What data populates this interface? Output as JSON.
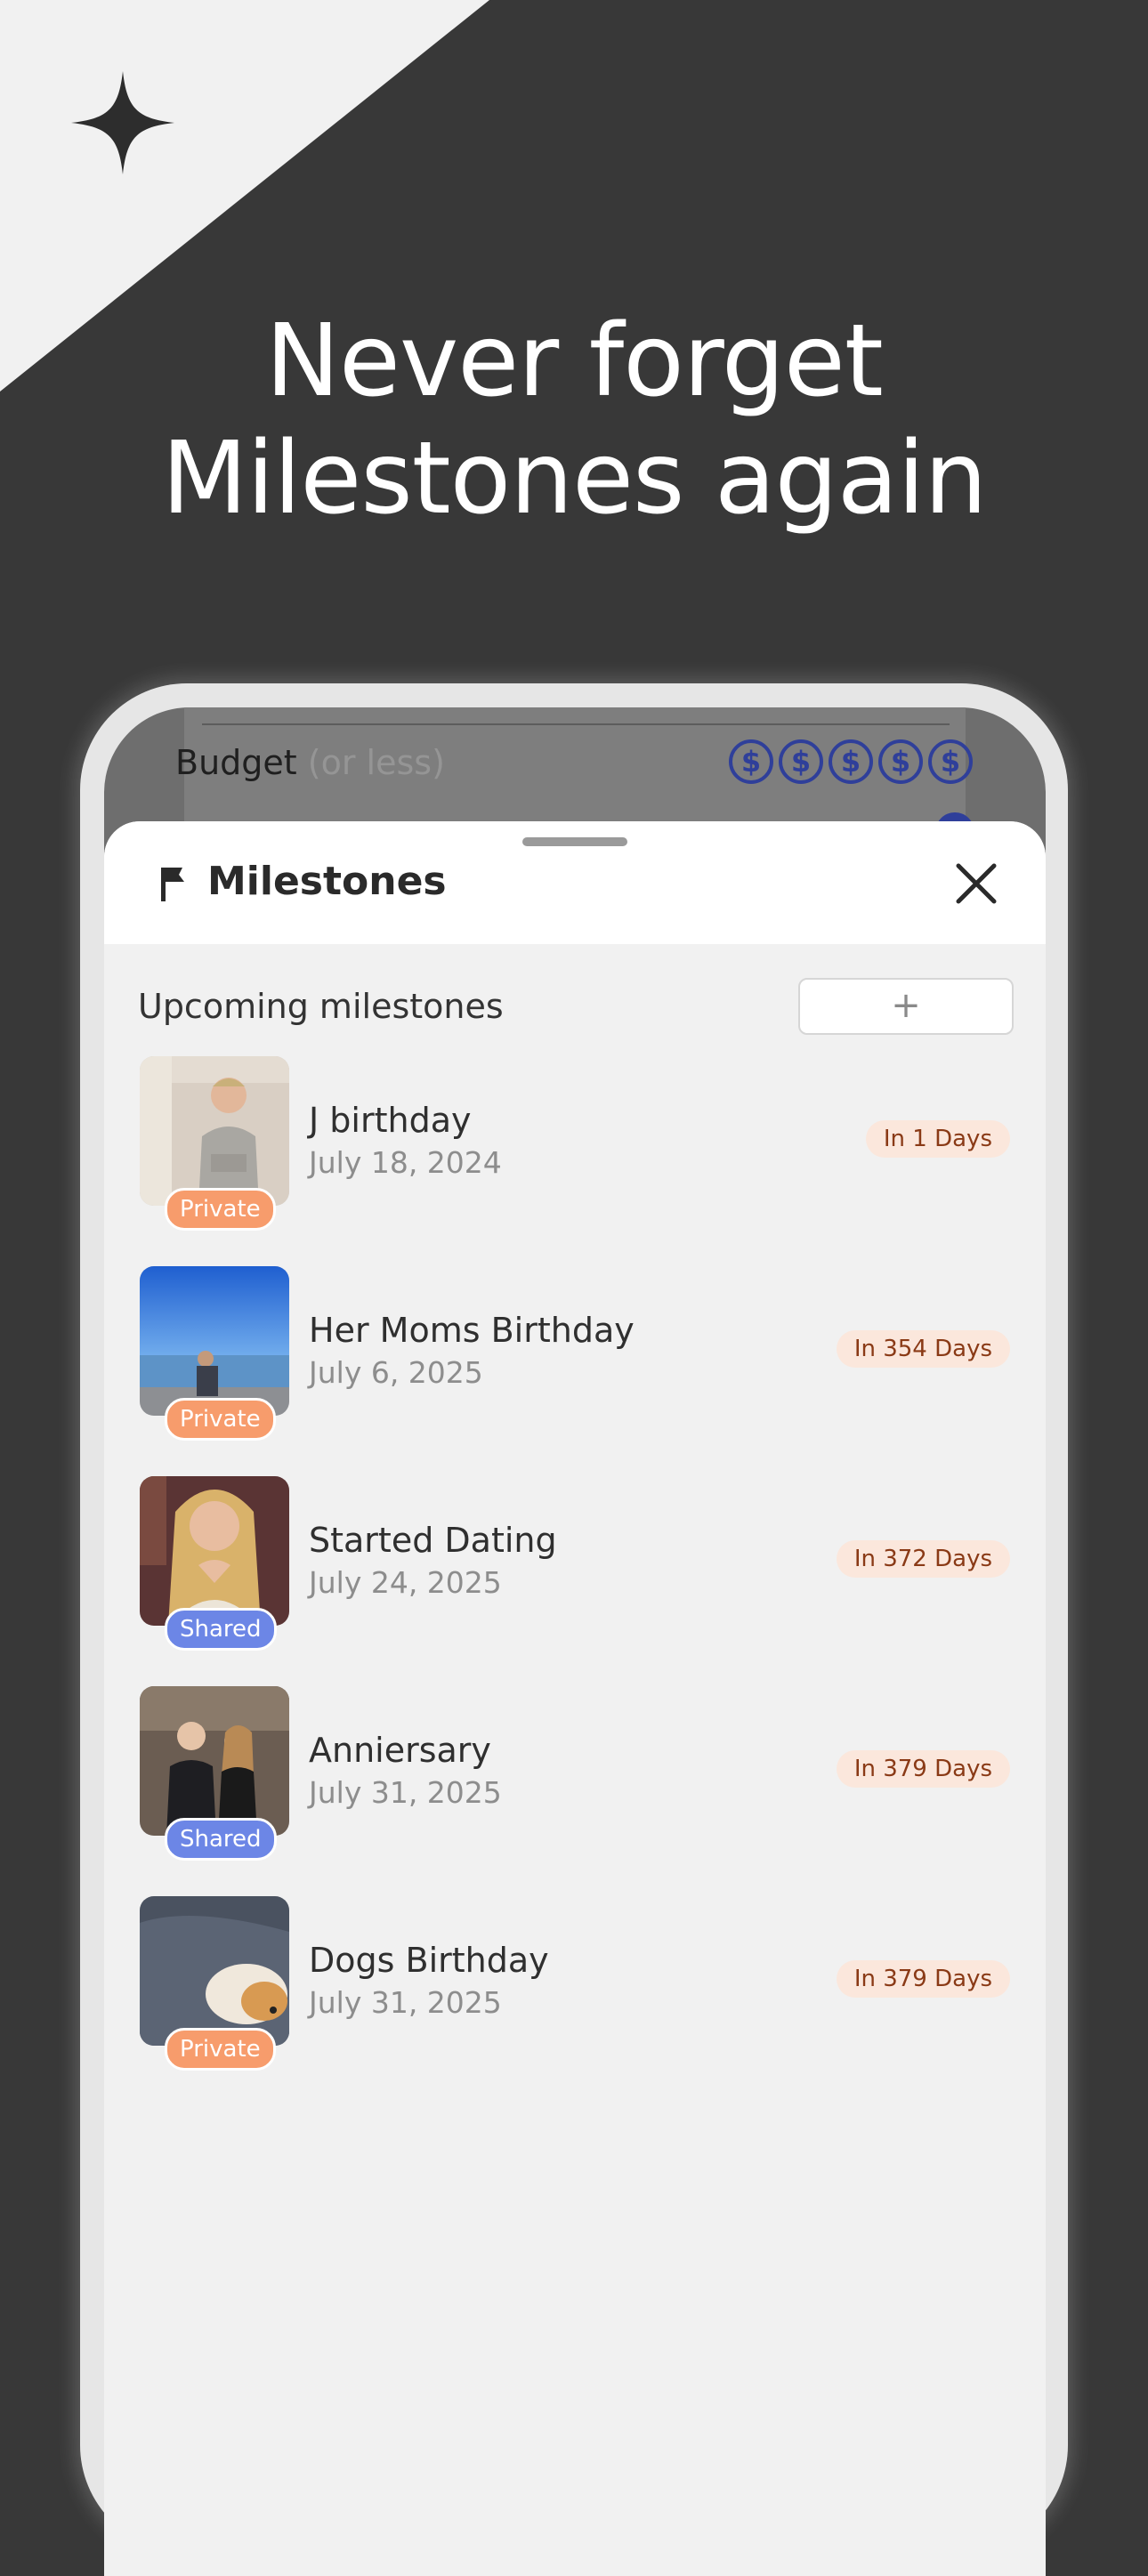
{
  "headline": {
    "line1": "Never forget",
    "line2": "Milestones again"
  },
  "background_screen": {
    "budget_label": "Budget",
    "budget_sub": "(or less)",
    "budget_icons": [
      "$",
      "$",
      "$",
      "$",
      "$"
    ]
  },
  "sheet": {
    "title": "Milestones",
    "section_title": "Upcoming milestones",
    "add_label": "+"
  },
  "milestones": [
    {
      "title": "J birthday",
      "date": "July 18, 2024",
      "badge": "Private",
      "badge_type": "private",
      "days": "In 1 Days"
    },
    {
      "title": "Her Moms Birthday",
      "date": "July 6, 2025",
      "badge": "Private",
      "badge_type": "private",
      "days": "In 354 Days"
    },
    {
      "title": "Started Dating",
      "date": "July 24, 2025",
      "badge": "Shared",
      "badge_type": "shared",
      "days": "In 372 Days"
    },
    {
      "title": "Anniersary",
      "date": "July 31, 2025",
      "badge": "Shared",
      "badge_type": "shared",
      "days": "In 379 Days"
    },
    {
      "title": "Dogs Birthday",
      "date": "July 31, 2025",
      "badge": "Private",
      "badge_type": "private",
      "days": "In 379 Days"
    }
  ],
  "colors": {
    "background": "#383838",
    "private_badge": "#f79c6c",
    "shared_badge": "#6c86e6",
    "days_pill": "#fbe7dc",
    "budget_accent": "#2f3f9a"
  }
}
